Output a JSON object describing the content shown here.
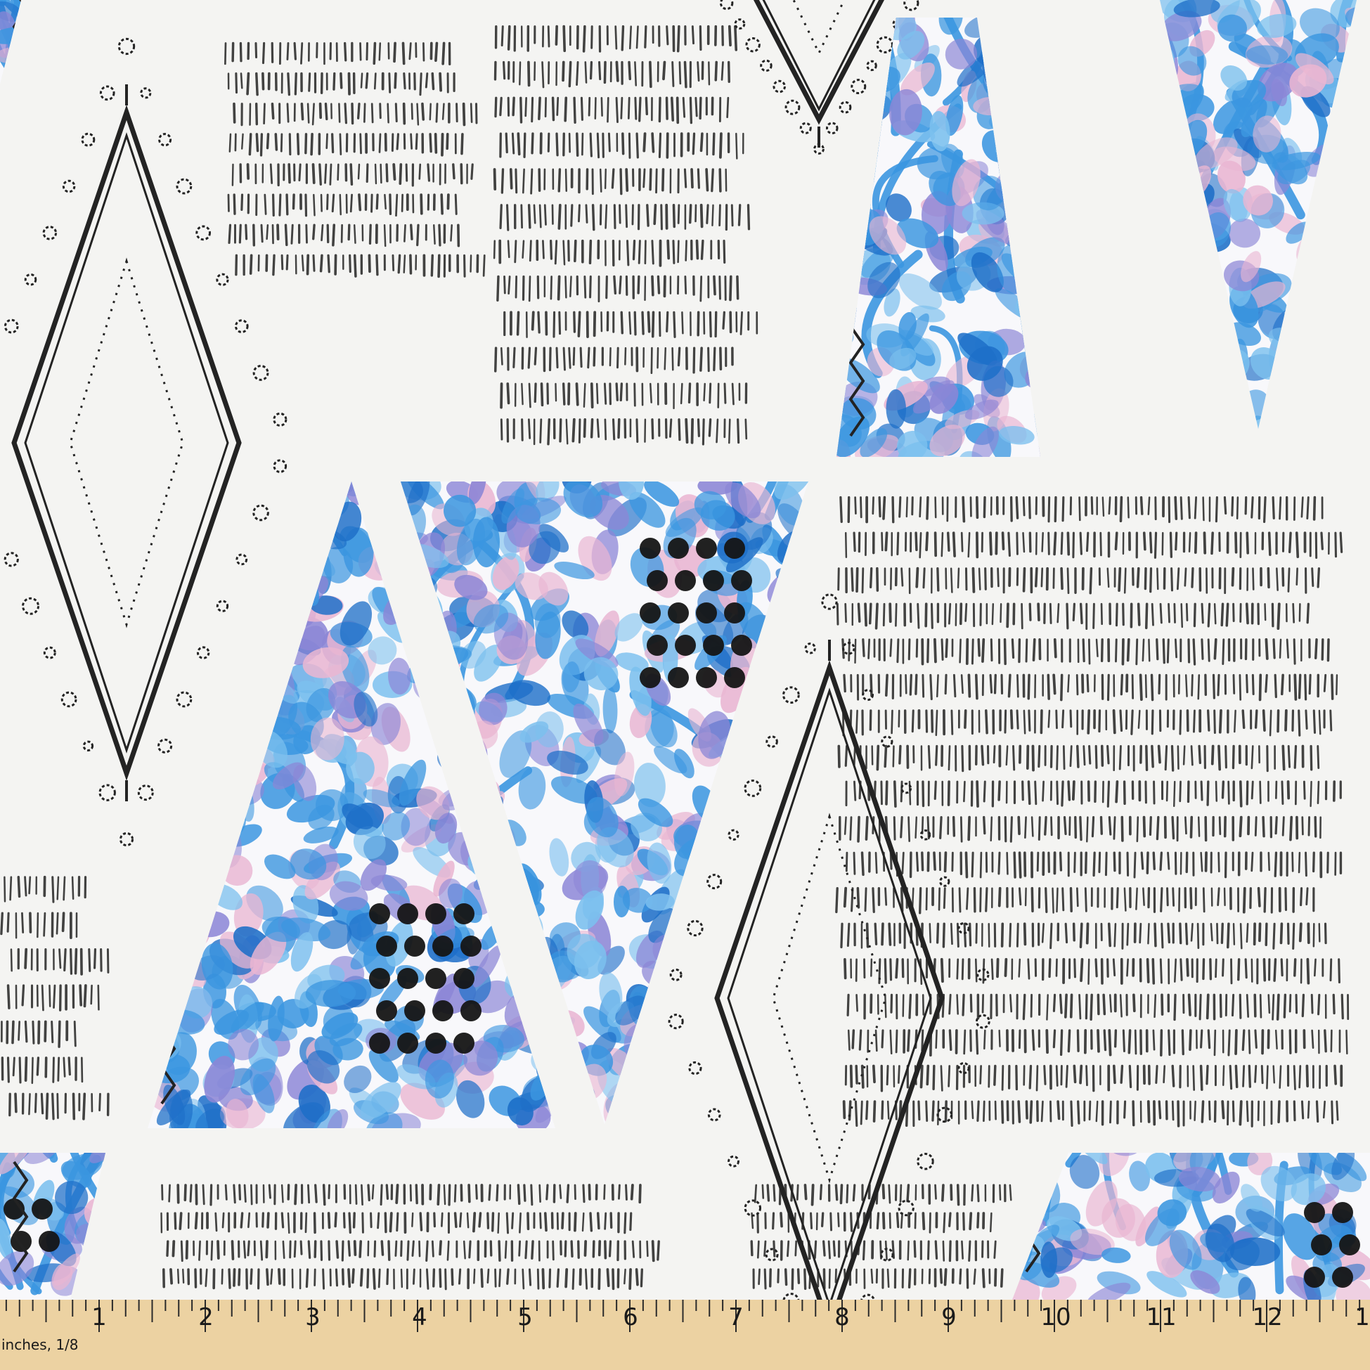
{
  "ruler": {
    "unit_label": "inches, 1/8",
    "numbers": [
      "1",
      "2",
      "3",
      "4",
      "5",
      "6",
      "7",
      "8",
      "9",
      "10",
      "11",
      "12",
      "1"
    ]
  },
  "colors": {
    "ink": "#232323",
    "background": "#f4f4f2",
    "blue_dark": "#1e6fc8",
    "blue_mid": "#3b96e0",
    "blue_light": "#7cc0ee",
    "lavender": "#8c86d6",
    "pink": "#e9b6d2",
    "ruler": "#ecd2a2"
  }
}
